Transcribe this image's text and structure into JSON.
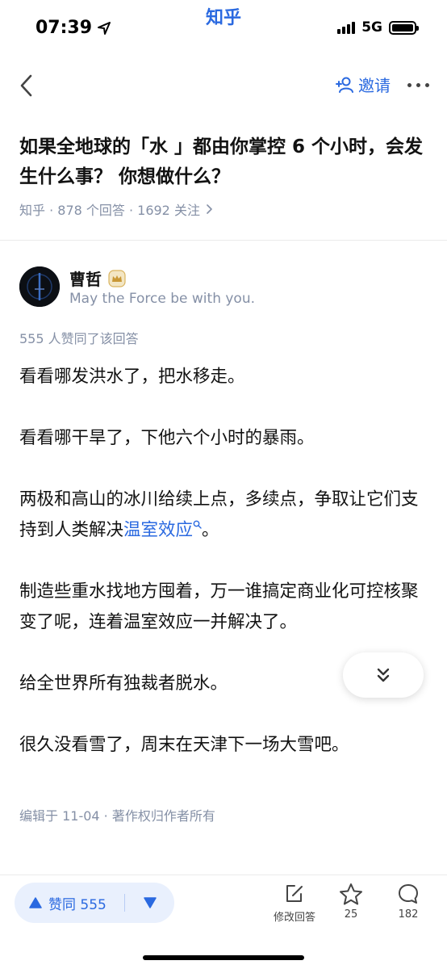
{
  "status_bar": {
    "time": "07:39",
    "app_name": "知乎",
    "network": "5G"
  },
  "nav": {
    "invite_label": "邀请"
  },
  "question": {
    "title": "如果全地球的「水 」都由你掌控 6 个小时，会发生什么事？ 你想做什么？",
    "meta": "知乎 · 878 个回答 · 1692 关注"
  },
  "author": {
    "name": "曹哲",
    "bio": "May the Force be with you."
  },
  "answer": {
    "likes_line": "555 人赞同了该回答",
    "paragraphs": {
      "p1": "看看哪发洪水了，把水移走。",
      "p2": "看看哪干旱了，下他六个小时的暴雨。",
      "p3_pre": "两极和高山的冰川给续上点，多续点，争取让它们支持到人类解决",
      "p3_link": "温室效应",
      "p3_post": "。",
      "p4": "制造些重水找地方囤着，万一谁搞定商业化可控核聚变了呢，连着温室效应一并解决了。",
      "p5": "给全世界所有独裁者脱水。",
      "p6": "很久没看雪了，周末在天津下一场大雪吧。"
    },
    "edit_info": "编辑于 11-04 · 著作权归作者所有"
  },
  "bottom_bar": {
    "vote_up_label": "赞同 555",
    "edit_label": "修改回答",
    "star_count": "25",
    "comment_count": "182"
  },
  "colors": {
    "accent": "#2a69e0",
    "meta_gray": "#8590a6",
    "vote_bg": "#e9f0fd"
  },
  "icons": {
    "back": "chevron-left-icon",
    "invite": "add-user-icon",
    "more": "more-dots-icon",
    "location": "location-arrow-icon",
    "badge": "crown-badge-icon",
    "collapse": "double-chevron-down-icon",
    "vote_up": "triangle-up-icon",
    "vote_down": "triangle-down-icon",
    "edit": "edit-icon",
    "star": "star-icon",
    "comment": "comment-icon"
  }
}
